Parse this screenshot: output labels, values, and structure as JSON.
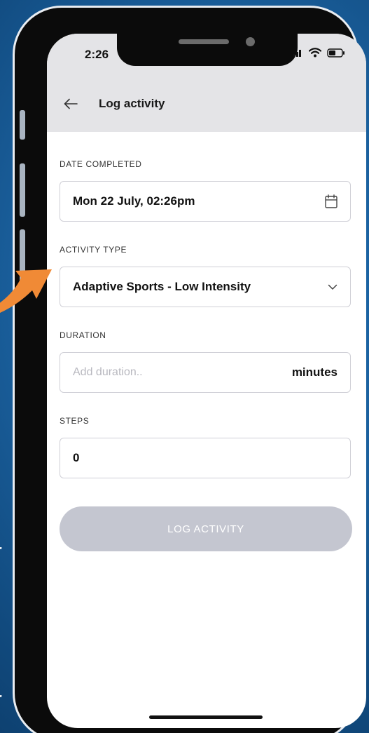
{
  "status_bar": {
    "time": "2:26"
  },
  "header": {
    "title": "Log activity",
    "back_icon": "arrow-left-icon"
  },
  "form": {
    "date_completed": {
      "label": "DATE COMPLETED",
      "value": "Mon 22 July, 02:26pm",
      "icon": "calendar-icon"
    },
    "activity_type": {
      "label": "ACTIVITY TYPE",
      "selected": "Adaptive Sports - Low Intensity",
      "icon": "chevron-down-icon"
    },
    "duration": {
      "label": "DURATION",
      "placeholder": "Add duration..",
      "unit": "minutes"
    },
    "steps": {
      "label": "STEPS",
      "value": "0"
    }
  },
  "actions": {
    "log_label": "LOG ACTIVITY"
  },
  "colors": {
    "background": "#1a5f9c",
    "header_bg": "#e4e4e7",
    "arrow": "#f08a36",
    "button_disabled": "#c4c6d0"
  }
}
